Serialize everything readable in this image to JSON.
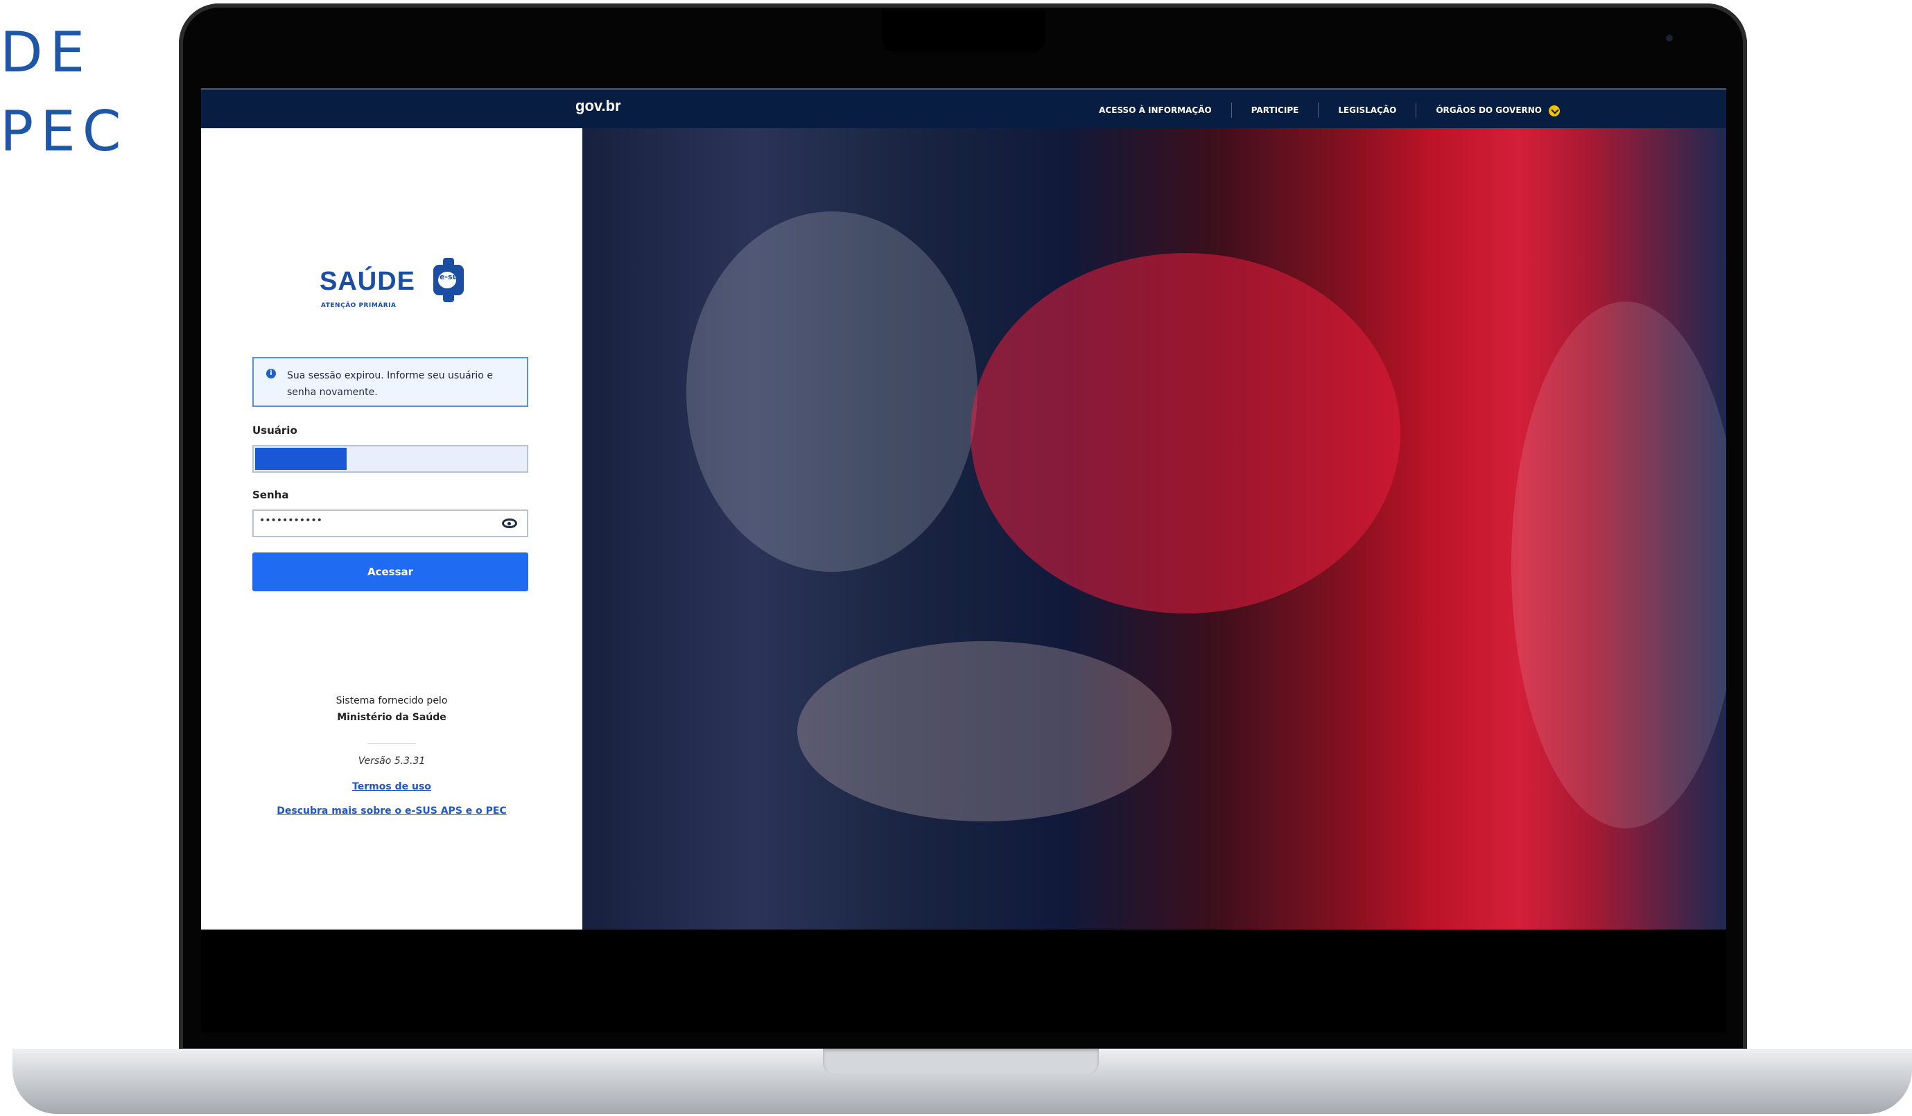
{
  "corner_text": [
    "DE",
    "PEC"
  ],
  "topbar": {
    "brand": "gov.br",
    "links": [
      "ACESSO À INFORMAÇÃO",
      "PARTICIPE",
      "LEGISLAÇÃO",
      "ÓRGÃOS DO GOVERNO"
    ]
  },
  "logo": {
    "title": "SAÚDE",
    "subtitle": "ATENÇÃO PRIMÁRIA",
    "mark": "e-sus"
  },
  "alert": {
    "message": "Sua sessão expirou. Informe seu usuário e senha novamente."
  },
  "form": {
    "username_label": "Usuário",
    "password_label": "Senha",
    "password_value": "•••••••••••",
    "submit_label": "Acessar"
  },
  "footer": {
    "provider_text": "Sistema fornecido pelo",
    "ministry": "Ministério da Saúde",
    "version": "Versão 5.3.31",
    "terms_link": "Termos de uso",
    "more_link": "Descubra mais sobre o e-SUS APS e o PEC"
  },
  "colors": {
    "brand_blue": "#1b4da3",
    "topbar": "#071d41",
    "button": "#1f6cf2",
    "alert_border": "#5b90d8"
  }
}
